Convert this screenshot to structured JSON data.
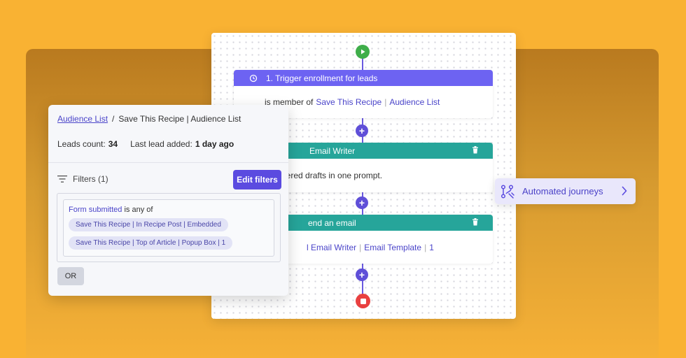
{
  "workflow": {
    "trigger": {
      "title": "1. Trigger enrollment for leads",
      "prefix": "is member of",
      "link1": "Save This Recipe",
      "link2": "Audience List"
    },
    "step2": {
      "title": "Email Writer",
      "body": "wered drafts in one prompt."
    },
    "step3": {
      "title": "end an email",
      "link1": "l Email Writer",
      "link2": "Email Template",
      "link3": "1"
    },
    "plus": "+"
  },
  "panel": {
    "breadcrumb_link": "Audience List",
    "breadcrumb_sep": "/",
    "breadcrumb_current": "Save This Recipe | Audience List",
    "leads_label": "Leads count:",
    "leads_value": "34",
    "last_label": "Last lead added:",
    "last_value": "1 day ago",
    "filters_label": "Filters (1)",
    "edit_button": "Edit filters",
    "rule_field": "Form submitted",
    "rule_op": "is any of",
    "chips": [
      "Save This Recipe | In Recipe Post | Embedded",
      "Save This Recipe | Top of Article | Popup Box | 1"
    ],
    "or_button": "OR"
  },
  "journeys": {
    "label": "Automated journeys"
  },
  "colors": {
    "background": "#f9b233",
    "accent": "#5b4be0",
    "teal": "#26a59a",
    "start": "#3fae4a",
    "stop": "#e94040"
  }
}
